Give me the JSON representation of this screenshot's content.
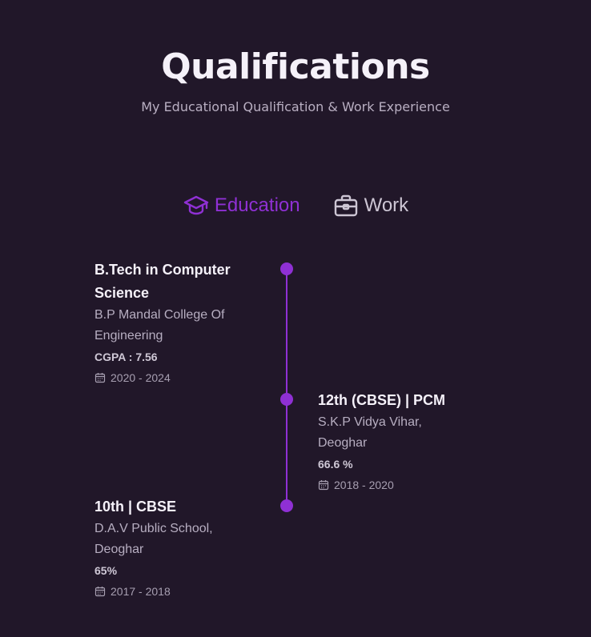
{
  "header": {
    "title": "Qualifications",
    "subtitle": "My Educational Qualification & Work Experience"
  },
  "tabs": [
    {
      "label": "Education",
      "icon": "graduation-cap-icon",
      "active": true
    },
    {
      "label": "Work",
      "icon": "briefcase-icon",
      "active": false
    }
  ],
  "colors": {
    "background": "#211729",
    "accent": "#8f30d4",
    "text": "#f5f1f9",
    "muted": "#b7aec1"
  },
  "timeline": [
    {
      "side": "left",
      "title_line1": "B.Tech in Computer",
      "title_line2": "Science",
      "inst_line1": "B.P Mandal College Of",
      "inst_line2": "Engineering",
      "score": "CGPA : 7.56",
      "date": "2020 - 2024"
    },
    {
      "side": "right",
      "title_line1": "12th (CBSE) | PCM",
      "inst_line1": "S.K.P Vidya Vihar,",
      "inst_line2": "Deoghar",
      "score": "66.6 %",
      "date": "2018 - 2020"
    },
    {
      "side": "left",
      "title_line1": "10th | CBSE",
      "inst_line1": "D.A.V Public School,",
      "inst_line2": "Deoghar",
      "score": "65%",
      "date": "2017 - 2018"
    }
  ]
}
